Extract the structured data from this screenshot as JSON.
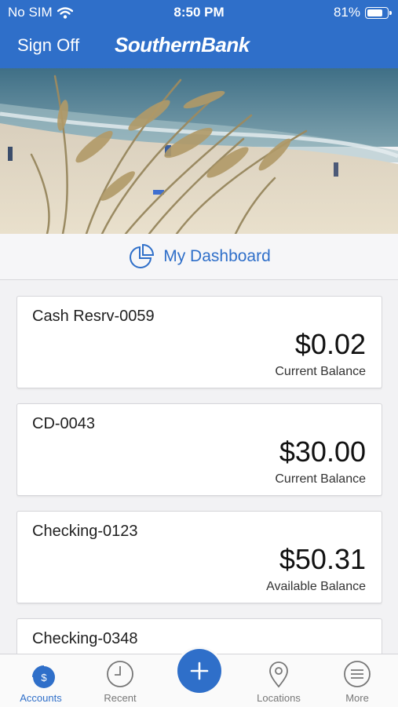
{
  "status_bar": {
    "carrier": "No SIM",
    "time": "8:50 PM",
    "battery": "81%"
  },
  "header": {
    "sign_off": "Sign Off",
    "brand": "SouthernBank"
  },
  "dashboard": {
    "label": "My Dashboard",
    "icon": "pie-chart-icon"
  },
  "accounts": [
    {
      "name": "Cash Resrv-0059",
      "amount": "$0.02",
      "balance_label": "Current Balance"
    },
    {
      "name": "CD-0043",
      "amount": "$30.00",
      "balance_label": "Current Balance"
    },
    {
      "name": "Checking-0123",
      "amount": "$50.31",
      "balance_label": "Available Balance"
    },
    {
      "name": "Checking-0348",
      "amount": "",
      "balance_label": ""
    }
  ],
  "tabs": [
    {
      "label": "Accounts",
      "icon": "dollar-coin-icon",
      "active": true
    },
    {
      "label": "Recent",
      "icon": "clock-icon",
      "active": false
    },
    {
      "label": "",
      "icon": "plus-icon",
      "active": false
    },
    {
      "label": "Locations",
      "icon": "map-pin-icon",
      "active": false
    },
    {
      "label": "More",
      "icon": "menu-icon",
      "active": false
    }
  ],
  "colors": {
    "brand_blue": "#2f6fc9",
    "background": "#f2f2f4"
  }
}
